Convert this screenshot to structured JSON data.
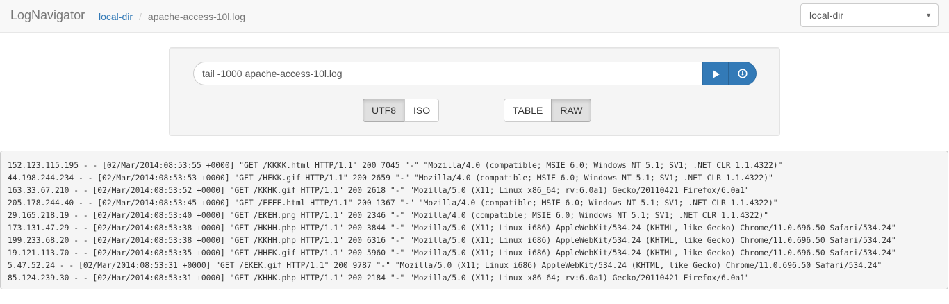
{
  "navbar": {
    "brand": "LogNavigator",
    "breadcrumb": {
      "link": "local-dir",
      "separator": "/",
      "current": "apache-access-10l.log"
    },
    "directory_select": {
      "value": "local-dir",
      "caret": "▼"
    }
  },
  "command": {
    "value": "tail -1000 apache-access-10l.log",
    "run_icon": "play-icon",
    "download_icon": "download-icon"
  },
  "encoding": {
    "options": [
      "UTF8",
      "ISO"
    ],
    "selected": "UTF8"
  },
  "view_mode": {
    "options": [
      "TABLE",
      "RAW"
    ],
    "selected": "RAW"
  },
  "colors": {
    "primary": "#337ab7",
    "navbar_bg": "#f8f8f8",
    "well_bg": "#f5f5f5",
    "active_toggle": "#e0e0e0"
  },
  "log": {
    "lines": [
      "152.123.115.195 - - [02/Mar/2014:08:53:55 +0000] \"GET /KKKK.html HTTP/1.1\" 200 7045 \"-\" \"Mozilla/4.0 (compatible; MSIE 6.0; Windows NT 5.1; SV1; .NET CLR 1.1.4322)\"",
      "44.198.244.234 - - [02/Mar/2014:08:53:53 +0000] \"GET /HEKK.gif HTTP/1.1\" 200 2659 \"-\" \"Mozilla/4.0 (compatible; MSIE 6.0; Windows NT 5.1; SV1; .NET CLR 1.1.4322)\"",
      "163.33.67.210 - - [02/Mar/2014:08:53:52 +0000] \"GET /KKHK.gif HTTP/1.1\" 200 2618 \"-\" \"Mozilla/5.0 (X11; Linux x86_64; rv:6.0a1) Gecko/20110421 Firefox/6.0a1\"",
      "205.178.244.40 - - [02/Mar/2014:08:53:45 +0000] \"GET /EEEE.html HTTP/1.1\" 200 1367 \"-\" \"Mozilla/4.0 (compatible; MSIE 6.0; Windows NT 5.1; SV1; .NET CLR 1.1.4322)\"",
      "29.165.218.19 - - [02/Mar/2014:08:53:40 +0000] \"GET /EKEH.png HTTP/1.1\" 200 2346 \"-\" \"Mozilla/4.0 (compatible; MSIE 6.0; Windows NT 5.1; SV1; .NET CLR 1.1.4322)\"",
      "173.131.47.29 - - [02/Mar/2014:08:53:38 +0000] \"GET /HKHH.php HTTP/1.1\" 200 3844 \"-\" \"Mozilla/5.0 (X11; Linux i686) AppleWebKit/534.24 (KHTML, like Gecko) Chrome/11.0.696.50 Safari/534.24\"",
      "199.233.68.20 - - [02/Mar/2014:08:53:38 +0000] \"GET /KKHH.php HTTP/1.1\" 200 6316 \"-\" \"Mozilla/5.0 (X11; Linux i686) AppleWebKit/534.24 (KHTML, like Gecko) Chrome/11.0.696.50 Safari/534.24\"",
      "19.121.113.70 - - [02/Mar/2014:08:53:35 +0000] \"GET /HHEK.gif HTTP/1.1\" 200 5960 \"-\" \"Mozilla/5.0 (X11; Linux i686) AppleWebKit/534.24 (KHTML, like Gecko) Chrome/11.0.696.50 Safari/534.24\"",
      "5.47.52.24 - - [02/Mar/2014:08:53:31 +0000] \"GET /EKEK.gif HTTP/1.1\" 200 9787 \"-\" \"Mozilla/5.0 (X11; Linux i686) AppleWebKit/534.24 (KHTML, like Gecko) Chrome/11.0.696.50 Safari/534.24\"",
      "85.124.239.30 - - [02/Mar/2014:08:53:31 +0000] \"GET /KHHK.php HTTP/1.1\" 200 2184 \"-\" \"Mozilla/5.0 (X11; Linux x86_64; rv:6.0a1) Gecko/20110421 Firefox/6.0a1\""
    ]
  }
}
